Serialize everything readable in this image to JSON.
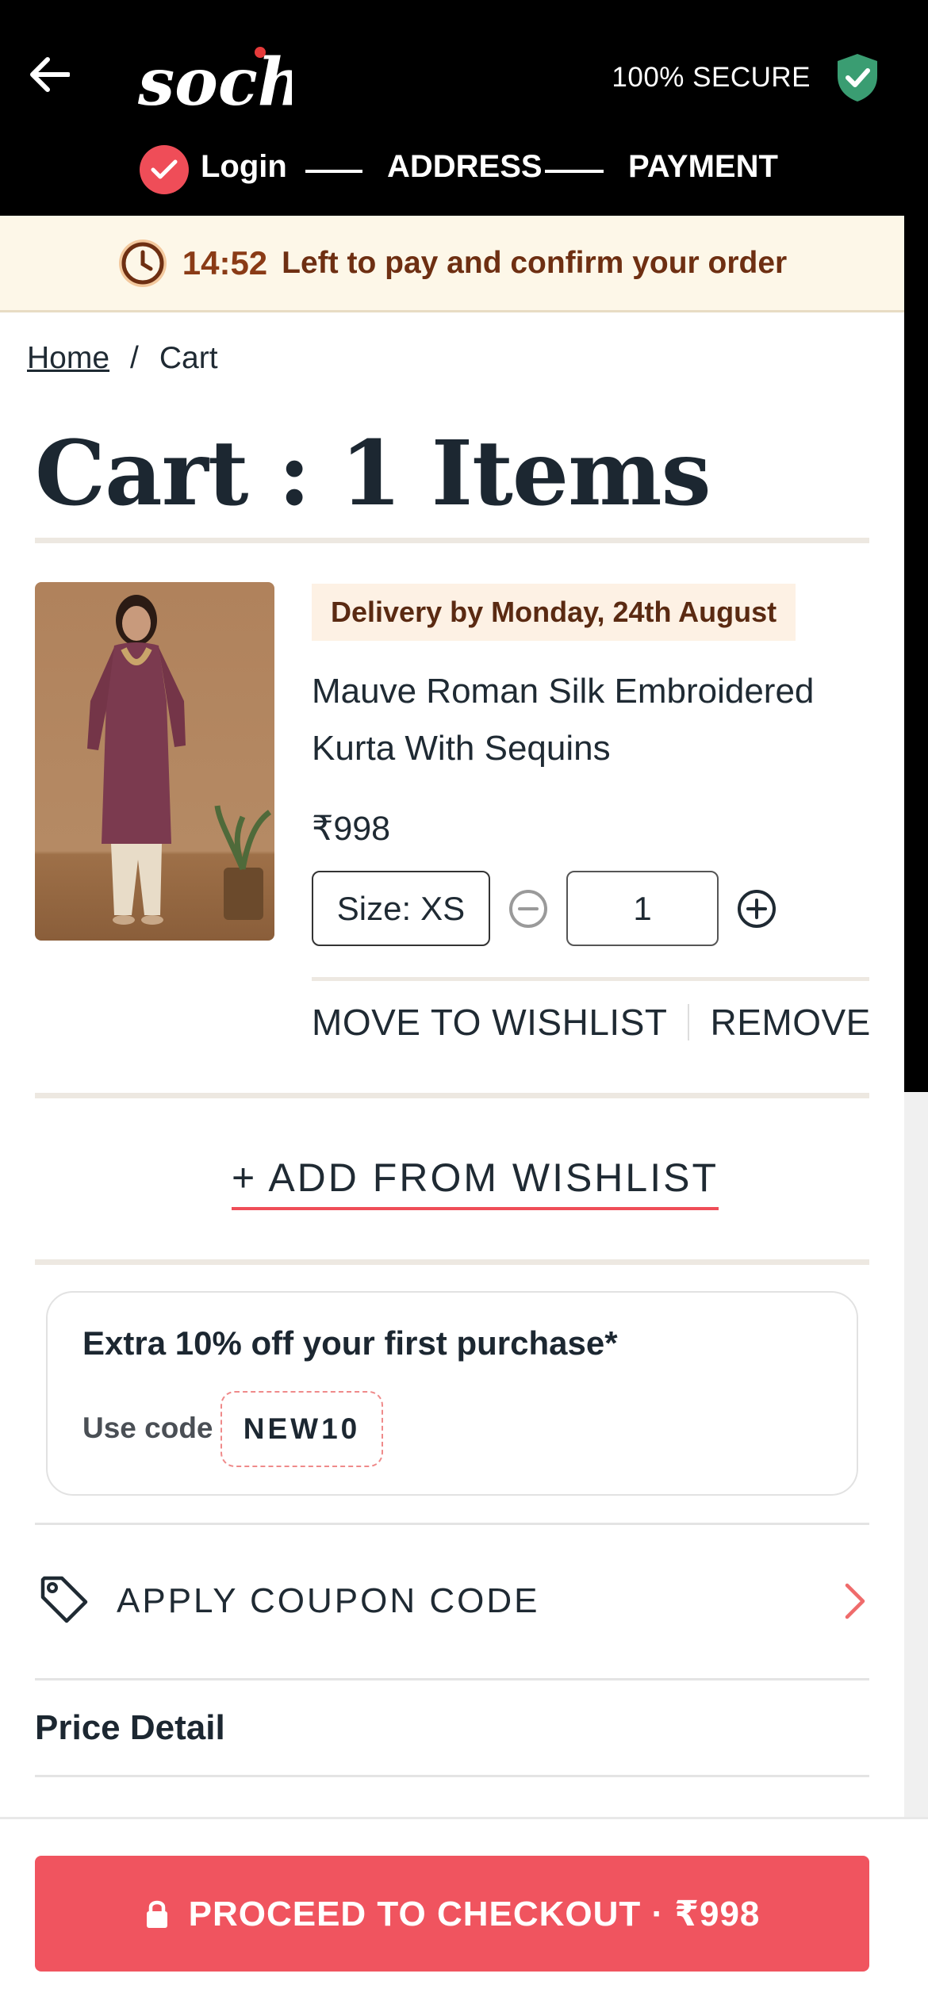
{
  "header": {
    "logo_text": "soch",
    "secure_text": "100% SECURE",
    "steps": [
      {
        "label": "Login",
        "done": true
      },
      {
        "label": "ADDRESS",
        "done": false
      },
      {
        "label": "PAYMENT",
        "done": false
      }
    ]
  },
  "timer": {
    "value": "14:52",
    "text": "Left to pay and confirm your order"
  },
  "breadcrumb": {
    "home": "Home",
    "separator": "/",
    "current": "Cart"
  },
  "cart": {
    "title": "Cart : 1 Items",
    "items": [
      {
        "delivery": "Delivery by Monday, 24th August",
        "name": "Mauve Roman Silk Embroidered Kurta With Sequins",
        "price": "₹998",
        "size_label": "Size:",
        "size_value": "XS",
        "quantity": "1",
        "move_to_wishlist": "MOVE TO WISHLIST",
        "remove": "REMOVE"
      }
    ],
    "add_from_wishlist": "+ ADD FROM WISHLIST"
  },
  "promo": {
    "title": "Extra 10% off your first purchase*",
    "use_code_label": "Use code",
    "code": "NEW10"
  },
  "coupon": {
    "label": "APPLY COUPON CODE",
    "icon": "tag-icon"
  },
  "price_detail": {
    "title": "Price Detail"
  },
  "checkout": {
    "label": "PROCEED TO CHECKOUT · ₹998",
    "icon": "lock-icon"
  },
  "colors": {
    "accent": "#f0545f",
    "header_bg": "#000000",
    "timer_bg": "#fdf7e8",
    "timer_text": "#8a3b16",
    "secure_shield": "#3a9d72"
  }
}
